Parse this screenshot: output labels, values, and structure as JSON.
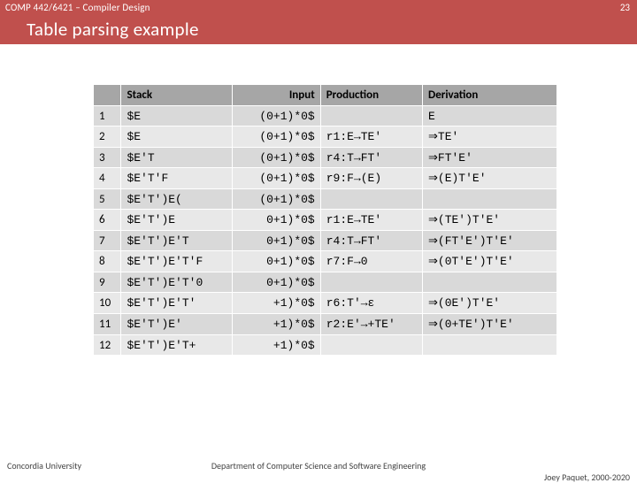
{
  "header": {
    "course": "COMP 442/6421 – Compiler Design",
    "slide_number": "23",
    "title": "Table parsing example"
  },
  "table": {
    "headers": {
      "step": "",
      "stack": "Stack",
      "input": "Input",
      "production": "Production",
      "derivation": "Derivation"
    },
    "rows": [
      {
        "step": "1",
        "stack": "$E",
        "input": "(0+1)*0$",
        "production": "",
        "derivation": "E"
      },
      {
        "step": "2",
        "stack": "$E",
        "input": "(0+1)*0$",
        "production": "r1:E→TE'",
        "derivation": "⇒TE'"
      },
      {
        "step": "3",
        "stack": "$E'T",
        "input": "(0+1)*0$",
        "production": "r4:T→FT'",
        "derivation": "⇒FT'E'"
      },
      {
        "step": "4",
        "stack": "$E'T'F",
        "input": "(0+1)*0$",
        "production": "r9:F→(E)",
        "derivation": "⇒(E)T'E'"
      },
      {
        "step": "5",
        "stack": "$E'T')E(",
        "input": "(0+1)*0$",
        "production": "",
        "derivation": ""
      },
      {
        "step": "6",
        "stack": "$E'T')E",
        "input": "0+1)*0$",
        "production": "r1:E→TE'",
        "derivation": "⇒(TE')T'E'"
      },
      {
        "step": "7",
        "stack": "$E'T')E'T",
        "input": "0+1)*0$",
        "production": "r4:T→FT'",
        "derivation": "⇒(FT'E')T'E'"
      },
      {
        "step": "8",
        "stack": "$E'T')E'T'F",
        "input": "0+1)*0$",
        "production": "r7:F→0",
        "derivation": "⇒(0T'E')T'E'"
      },
      {
        "step": "9",
        "stack": "$E'T')E'T'0",
        "input": "0+1)*0$",
        "production": "",
        "derivation": ""
      },
      {
        "step": "10",
        "stack": "$E'T')E'T'",
        "input": "+1)*0$",
        "production": "r6:T'→ε",
        "derivation": "⇒(0E')T'E'"
      },
      {
        "step": "11",
        "stack": "$E'T')E'",
        "input": "+1)*0$",
        "production": "r2:E'→+TE'",
        "derivation": "⇒(0+TE')T'E'"
      },
      {
        "step": "12",
        "stack": "$E'T')E'T+",
        "input": "+1)*0$",
        "production": "",
        "derivation": ""
      }
    ]
  },
  "footer": {
    "left": "Concordia University",
    "center": "Department of Computer Science and Software Engineering",
    "right": "Joey Paquet, 2000-2020"
  }
}
